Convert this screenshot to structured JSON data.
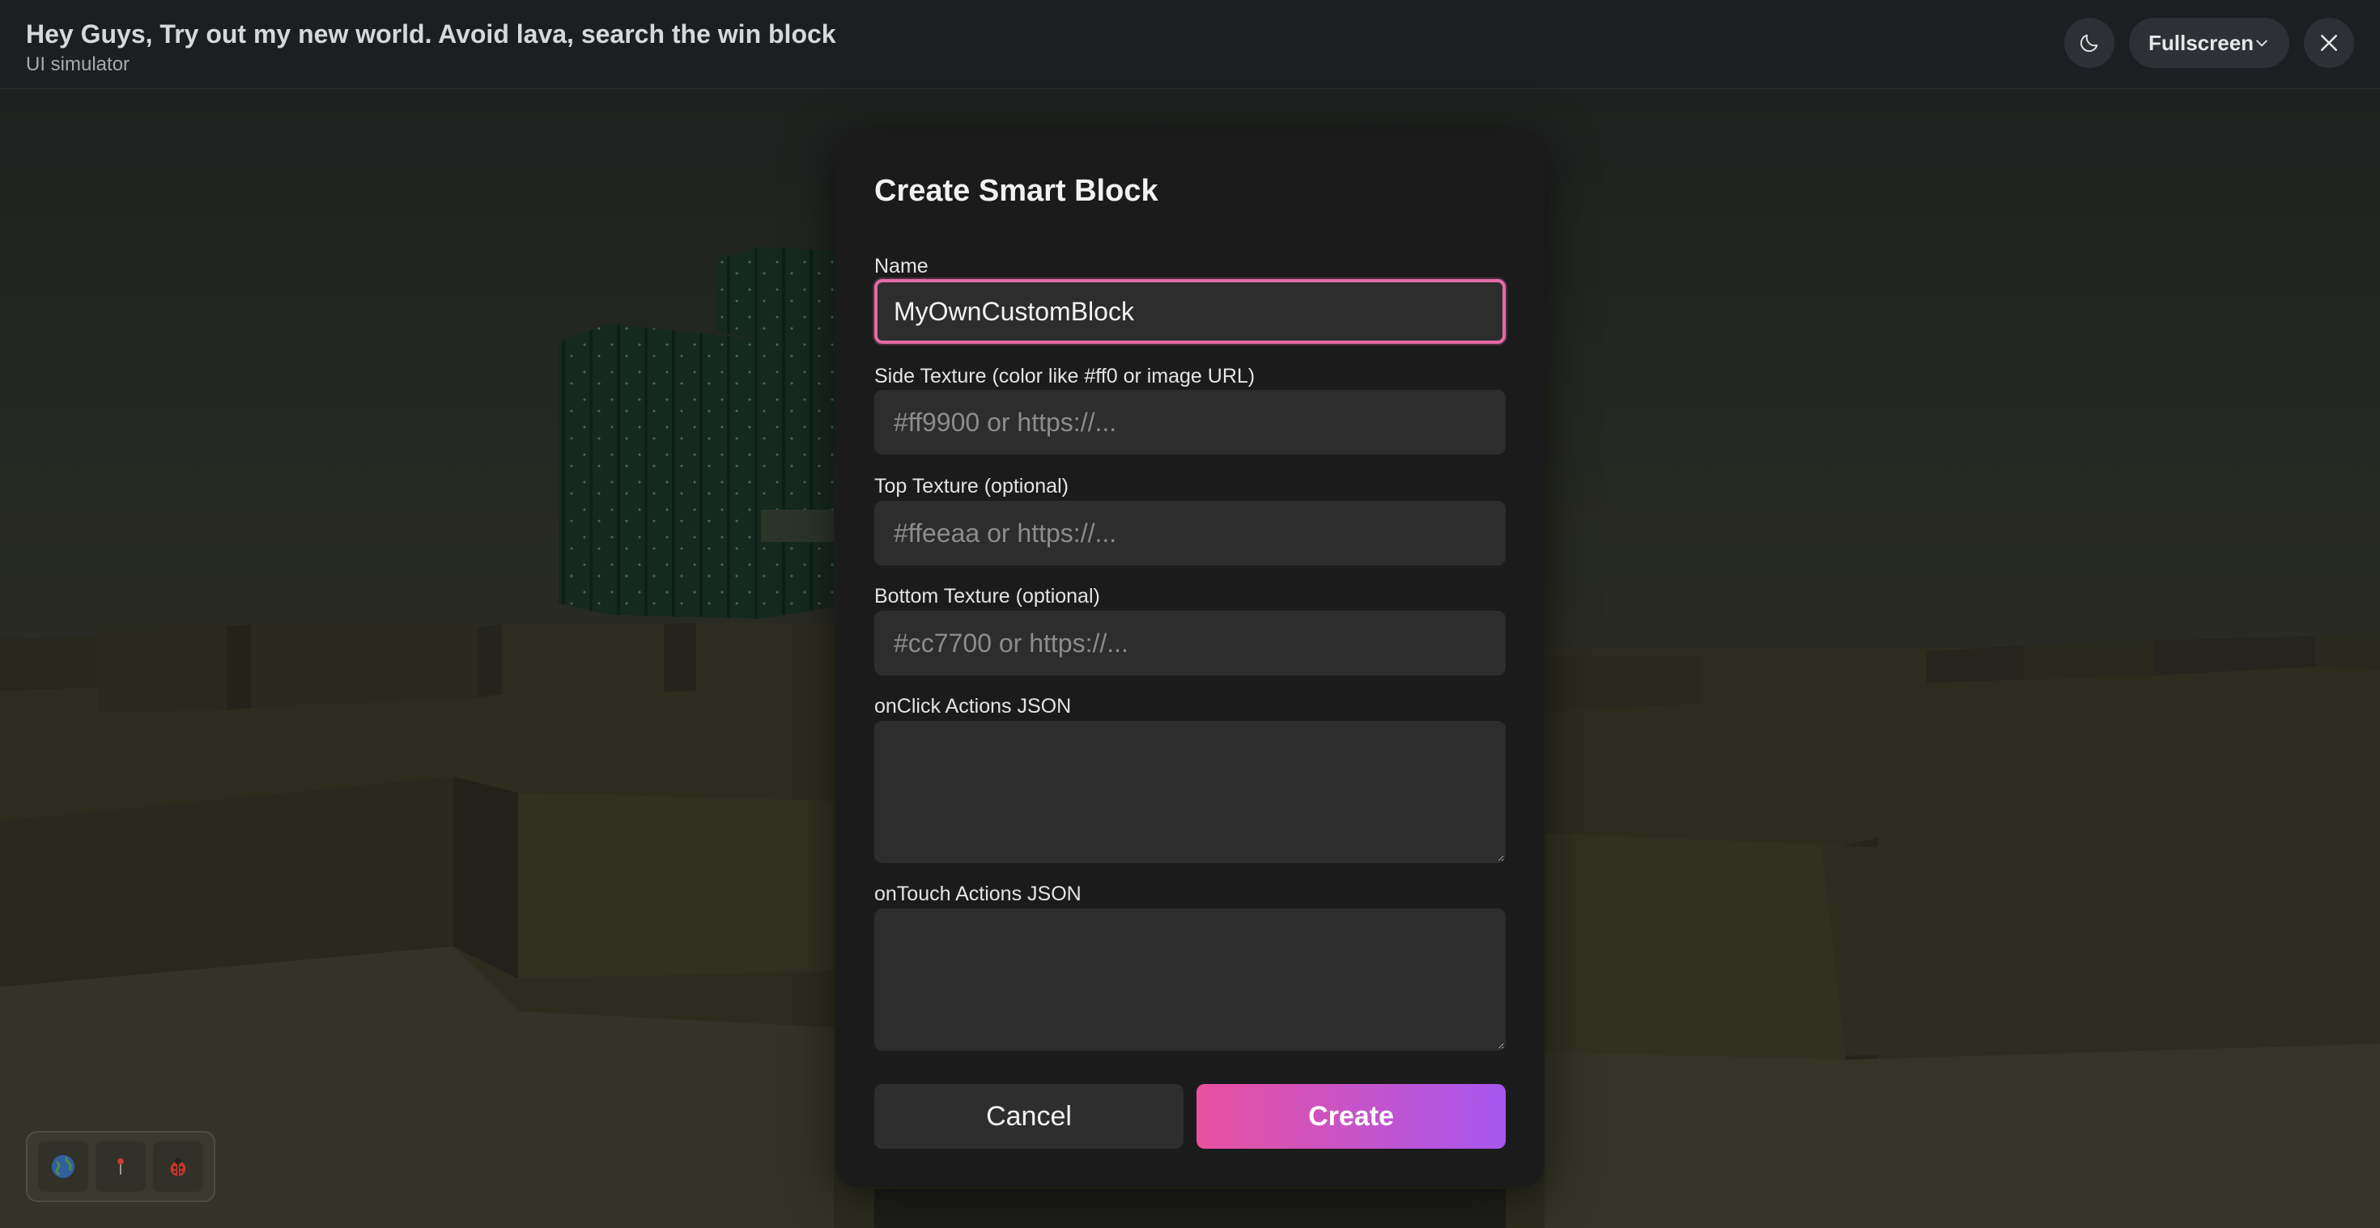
{
  "header": {
    "title": "Hey Guys, Try out my new world. Avoid lava, search the win block",
    "subtitle": "UI simulator",
    "theme_icon": "moon-icon",
    "fullscreen_label": "Fullscreen",
    "close_icon": "close-icon"
  },
  "modal": {
    "title": "Create Smart Block",
    "fields": {
      "name": {
        "label": "Name",
        "value": "MyOwnCustomBlock",
        "placeholder": ""
      },
      "side_texture": {
        "label": "Side Texture (color like #ff0 or image URL)",
        "value": "",
        "placeholder": "#ff9900 or https://..."
      },
      "top_texture": {
        "label": "Top Texture (optional)",
        "value": "",
        "placeholder": "#ffeeaa or https://..."
      },
      "bottom_texture": {
        "label": "Bottom Texture (optional)",
        "value": "",
        "placeholder": "#cc7700 or https://..."
      },
      "onclick_actions": {
        "label": "onClick Actions JSON",
        "value": ""
      },
      "ontouch_actions": {
        "label": "onTouch Actions JSON",
        "value": ""
      }
    },
    "cancel_label": "Cancel",
    "create_label": "Create"
  },
  "hotbar": {
    "slots": [
      "globe-icon",
      "pin-icon",
      "ladybug-icon"
    ]
  },
  "colors": {
    "accent_focus": "#e46aa6",
    "create_gradient_start": "#e9509f",
    "create_gradient_end": "#a657ef",
    "modal_bg": "#1b1b1b",
    "header_bg": "#1c1f22"
  }
}
